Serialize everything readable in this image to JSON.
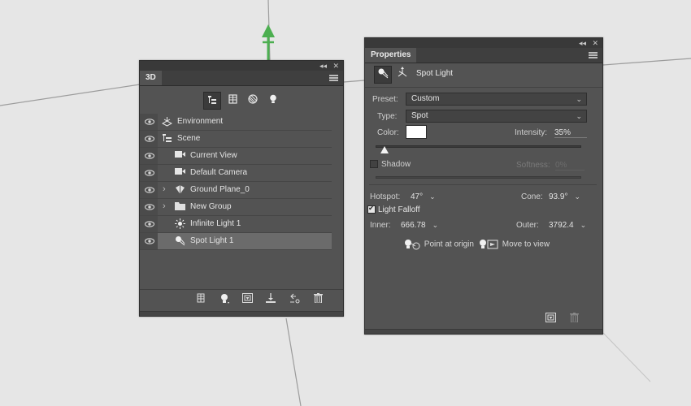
{
  "colors": {
    "canvas_bg": "#e6e6e6",
    "guide_line": "#9c9c9c",
    "gizmo_green": "#4caf50",
    "panel_bg": "#535353",
    "selected_row": "#6b6b6b",
    "light_color": "#ffffff"
  },
  "panel_3d": {
    "tab": "3D",
    "filters": [
      "scene-filter-icon",
      "mesh-filter-icon",
      "material-filter-icon",
      "light-filter-icon"
    ],
    "layers": [
      {
        "label": "Environment",
        "icon": "environment-icon",
        "visible": true,
        "expandable": false,
        "indent": 0
      },
      {
        "label": "Scene",
        "icon": "scene-icon",
        "visible": true,
        "expandable": false,
        "indent": 0
      },
      {
        "label": "Current View",
        "icon": "camera-icon",
        "visible": true,
        "expandable": false,
        "indent": 1
      },
      {
        "label": "Default Camera",
        "icon": "camera-icon",
        "visible": true,
        "expandable": false,
        "indent": 1
      },
      {
        "label": "Ground Plane_0",
        "icon": "mesh-icon",
        "visible": true,
        "expandable": true,
        "indent": 1
      },
      {
        "label": "New Group",
        "icon": "folder-icon",
        "visible": true,
        "expandable": true,
        "indent": 1
      },
      {
        "label": "Infinite Light 1",
        "icon": "infinite-light-icon",
        "visible": true,
        "expandable": false,
        "indent": 1
      },
      {
        "label": "Spot Light 1",
        "icon": "spot-light-icon",
        "visible": true,
        "expandable": false,
        "indent": 1,
        "selected": true
      }
    ],
    "bottom_tools": [
      "mesh-add-icon",
      "light-add-icon",
      "material-icon",
      "drop-to-plane-icon",
      "render-icon",
      "trash-icon"
    ]
  },
  "properties": {
    "tab": "Properties",
    "title": "Spot Light",
    "preset_label": "Preset:",
    "preset_value": "Custom",
    "type_label": "Type:",
    "type_value": "Spot",
    "color_label": "Color:",
    "intensity_label": "Intensity:",
    "intensity_value": "35%",
    "intensity_fraction": 0.35,
    "shadow_label": "Shadow",
    "shadow_checked": false,
    "softness_label": "Softness:",
    "softness_value": "0%",
    "hotspot_label": "Hotspot:",
    "hotspot_value": "47°",
    "cone_label": "Cone:",
    "cone_value": "93.9°",
    "light_falloff_label": "Light Falloff",
    "light_falloff_checked": true,
    "inner_label": "Inner:",
    "inner_value": "666.78",
    "outer_label": "Outer:",
    "outer_value": "3792.4",
    "point_at_origin": "Point at origin",
    "move_to_view": "Move to view"
  }
}
